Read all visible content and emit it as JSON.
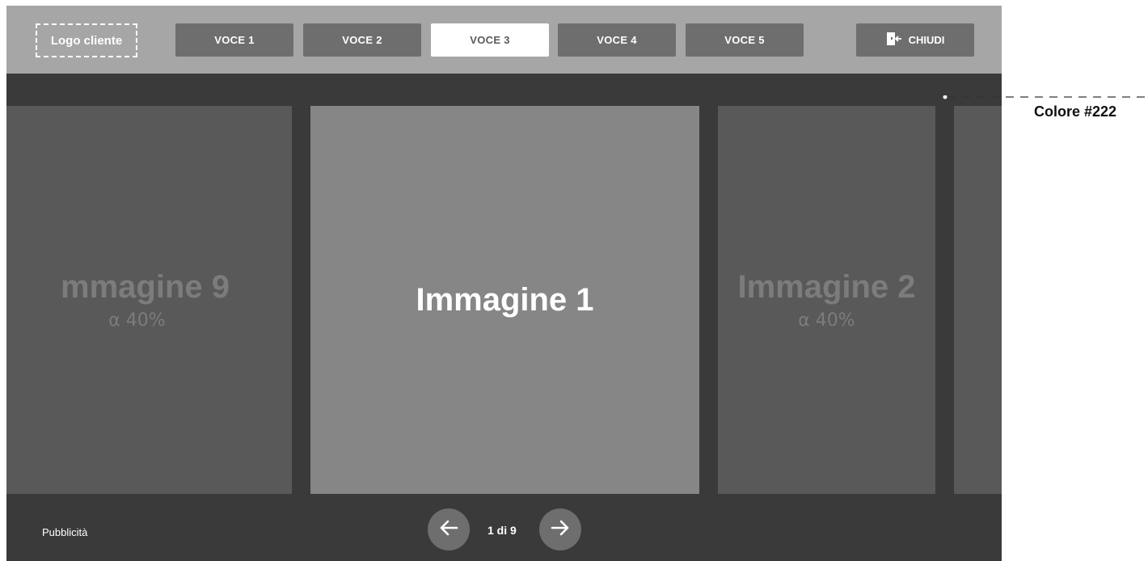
{
  "header": {
    "logo_label": "Logo cliente",
    "nav_items": [
      "VOCE 1",
      "VOCE 2",
      "VOCE 3",
      "VOCE 4",
      "VOCE 5"
    ],
    "active_nav": "VOCE 3",
    "close_label": "CHIUDI"
  },
  "carousel": {
    "prev_slide": {
      "title": "mmagine 9",
      "subtitle": "α 40%"
    },
    "current_slide": {
      "title": "Immagine 1"
    },
    "next_slide": {
      "title": "Immagine 2",
      "subtitle": "α 40%"
    }
  },
  "footer": {
    "ad_label": "Pubblicità",
    "pager": "1 di 9"
  },
  "annotation": {
    "label": "Colore #222"
  },
  "colors": {
    "background": "#3a3a3a",
    "topbar": "#a6a6a6",
    "button": "#6e6e6e",
    "active_button": "#ffffff",
    "main_slide": "#868686",
    "side_slide": "#595959"
  }
}
